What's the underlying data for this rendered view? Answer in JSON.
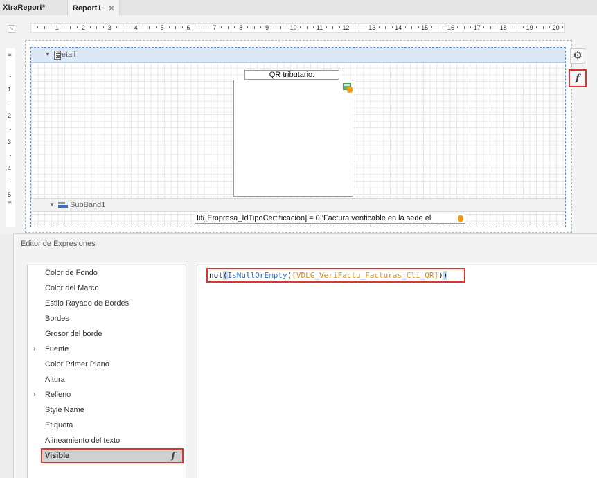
{
  "tabs": [
    {
      "label": "XtraReport*",
      "active": false
    },
    {
      "label": "Report1",
      "active": true,
      "close": "✕"
    }
  ],
  "ruler": {
    "h_numbers": [
      "1",
      "2",
      "3",
      "4",
      "5",
      "6",
      "7",
      "8",
      "9",
      "10",
      "11",
      "12",
      "13",
      "14",
      "15",
      "16",
      "17",
      "18",
      "19",
      "20"
    ],
    "v_numbers": [
      "1",
      "2",
      "3",
      "4",
      "5"
    ]
  },
  "bands": {
    "detail_label": "Detail",
    "subband_label": "SubBand1"
  },
  "controls": {
    "qr_label": "QR tributario:",
    "expression_text": "Iif([Empresa_IdTipoCertificacion] = 0,'Factura verificable en la sede el"
  },
  "editor": {
    "title": "Editor de Expresiones",
    "properties": [
      {
        "label": "Color de Fondo",
        "expandable": false
      },
      {
        "label": "Color del Marco",
        "expandable": false
      },
      {
        "label": "Estilo Rayado de Bordes",
        "expandable": false
      },
      {
        "label": "Bordes",
        "expandable": false
      },
      {
        "label": "Grosor del borde",
        "expandable": false
      },
      {
        "label": "Fuente",
        "expandable": true
      },
      {
        "label": "Color Primer Plano",
        "expandable": false
      },
      {
        "label": "Altura",
        "expandable": false
      },
      {
        "label": "Relleno",
        "expandable": true
      },
      {
        "label": "Style Name",
        "expandable": false
      },
      {
        "label": "Etiqueta",
        "expandable": false
      },
      {
        "label": "Alineamiento del texto",
        "expandable": false
      },
      {
        "label": "Visible",
        "expandable": false,
        "selected": true
      }
    ],
    "code": {
      "kw": "not",
      "open1": "(",
      "fn": "IsNullOrEmpty",
      "open2": "(",
      "field": "[VDLG_VeriFactu_Facturas_Cli_QR]",
      "close2": ")",
      "close1": ")"
    }
  },
  "icons": {
    "gear": "⚙",
    "fx": "f",
    "chevron": "›",
    "triangle": "▼",
    "handle": "≡"
  },
  "colors": {
    "highlight_border": "#e0332f",
    "band_header": "#dde8f7",
    "function": "#2b6cc4",
    "field": "#e08a1c"
  }
}
